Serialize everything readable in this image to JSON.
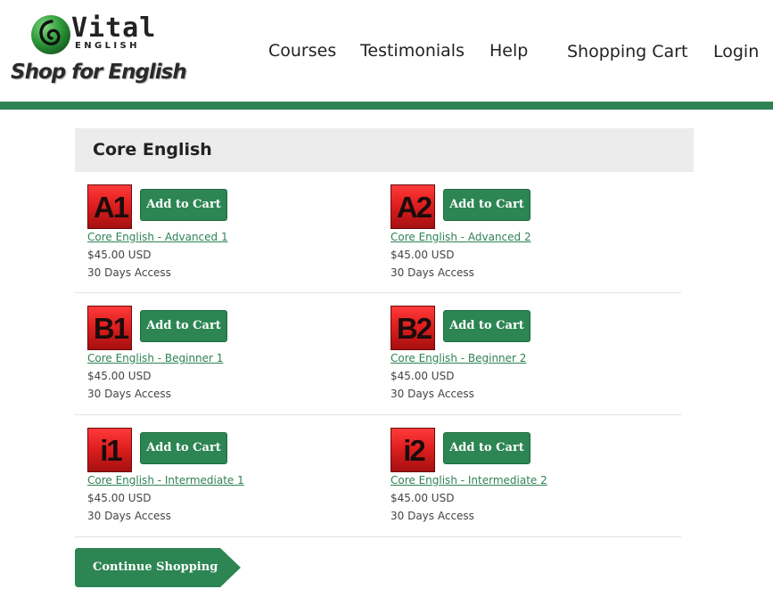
{
  "brand": {
    "name": "Vital",
    "sub": "ENGLISH",
    "tagline": "Shop for English"
  },
  "nav": [
    "Courses",
    "Testimonials",
    "Help",
    "Shopping Cart",
    "Login"
  ],
  "colors": {
    "accent": "#2e8254",
    "badge": "#e01f1f",
    "panel": "#ececec"
  },
  "section": {
    "title": "Core English"
  },
  "add_label": "Add to Cart",
  "products": [
    {
      "badge": "A1",
      "name": "Core English - Advanced 1",
      "price": "$45.00 USD",
      "access": "30 Days Access"
    },
    {
      "badge": "A2",
      "name": "Core English - Advanced 2",
      "price": "$45.00 USD",
      "access": "30 Days Access"
    },
    {
      "badge": "B1",
      "name": "Core English - Beginner 1",
      "price": "$45.00 USD",
      "access": "30 Days Access"
    },
    {
      "badge": "B2",
      "name": "Core English - Beginner 2",
      "price": "$45.00 USD",
      "access": "30 Days Access"
    },
    {
      "badge": "i1",
      "name": "Core English - Intermediate 1",
      "price": "$45.00 USD",
      "access": "30 Days Access"
    },
    {
      "badge": "i2",
      "name": "Core English - Intermediate 2",
      "price": "$45.00 USD",
      "access": "30 Days Access"
    }
  ],
  "continue_label": "Continue Shopping"
}
